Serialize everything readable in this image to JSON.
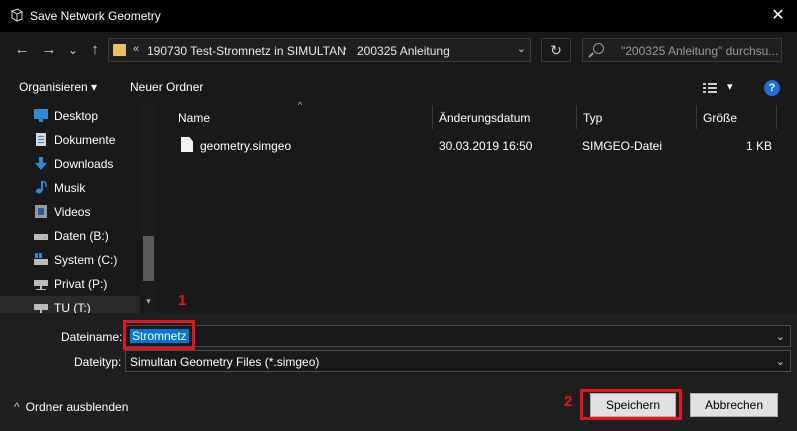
{
  "window": {
    "title": "Save Network Geometry",
    "close_glyph": "✕"
  },
  "nav": {
    "back": "←",
    "forward": "→",
    "recent": "⌄",
    "up": "↑",
    "breadcrumb_overflow": "«",
    "crumbs": [
      "190730 Test-Stromnetz in SIMULTAN",
      "200325 Anleitung"
    ],
    "separator": "›",
    "address_chevron": "⌄",
    "refresh": "↻",
    "search_placeholder": "\"200325 Anleitung\" durchsu..."
  },
  "toolbar": {
    "organize": "Organisieren ▾",
    "new_folder": "Neuer Ordner",
    "view_menu": "▾",
    "help": "?"
  },
  "sidebar": {
    "items": [
      {
        "label": "Desktop",
        "icon": "desktop-icon",
        "color": "#2e8bd6"
      },
      {
        "label": "Dokumente",
        "icon": "documents-icon",
        "color": "#d8d8d8"
      },
      {
        "label": "Downloads",
        "icon": "downloads-icon",
        "color": "#2e8bd6"
      },
      {
        "label": "Musik",
        "icon": "music-icon",
        "color": "#2e8bd6"
      },
      {
        "label": "Videos",
        "icon": "videos-icon",
        "color": "#9a9a9a"
      },
      {
        "label": "Daten (B:)",
        "icon": "drive-icon",
        "color": "#bbbbbb"
      },
      {
        "label": "System (C:)",
        "icon": "system-drive-icon",
        "color": "#bbbbbb"
      },
      {
        "label": "Privat (P:)",
        "icon": "network-drive-icon",
        "color": "#bbbbbb"
      },
      {
        "label": "TU (T:)",
        "icon": "network-drive-icon",
        "color": "#bbbbbb"
      }
    ],
    "scroll_down": "▾"
  },
  "columns": {
    "name": "Name",
    "date": "Änderungsdatum",
    "type": "Typ",
    "size": "Größe",
    "sort_indicator": "^"
  },
  "files": [
    {
      "name": "geometry.simgeo",
      "date": "30.03.2019 16:50",
      "type": "SIMGEO-Datei",
      "size": "1 KB"
    }
  ],
  "form": {
    "filename_label": "Dateiname:",
    "filename_value": "Stromnetz",
    "filetype_label": "Dateityp:",
    "filetype_value": "Simultan Geometry Files (*.simgeo)",
    "chevron": "⌄"
  },
  "annotations": {
    "one": "1",
    "two": "2"
  },
  "buttons": {
    "save": "Speichern",
    "cancel": "Abbrechen",
    "hide_folders": "Ordner ausblenden",
    "hide_glyph": "^"
  },
  "colors": {
    "highlight": "#e6141c",
    "selection": "#0078d7",
    "folder": "#e8c160",
    "help": "#1e6fd6"
  }
}
